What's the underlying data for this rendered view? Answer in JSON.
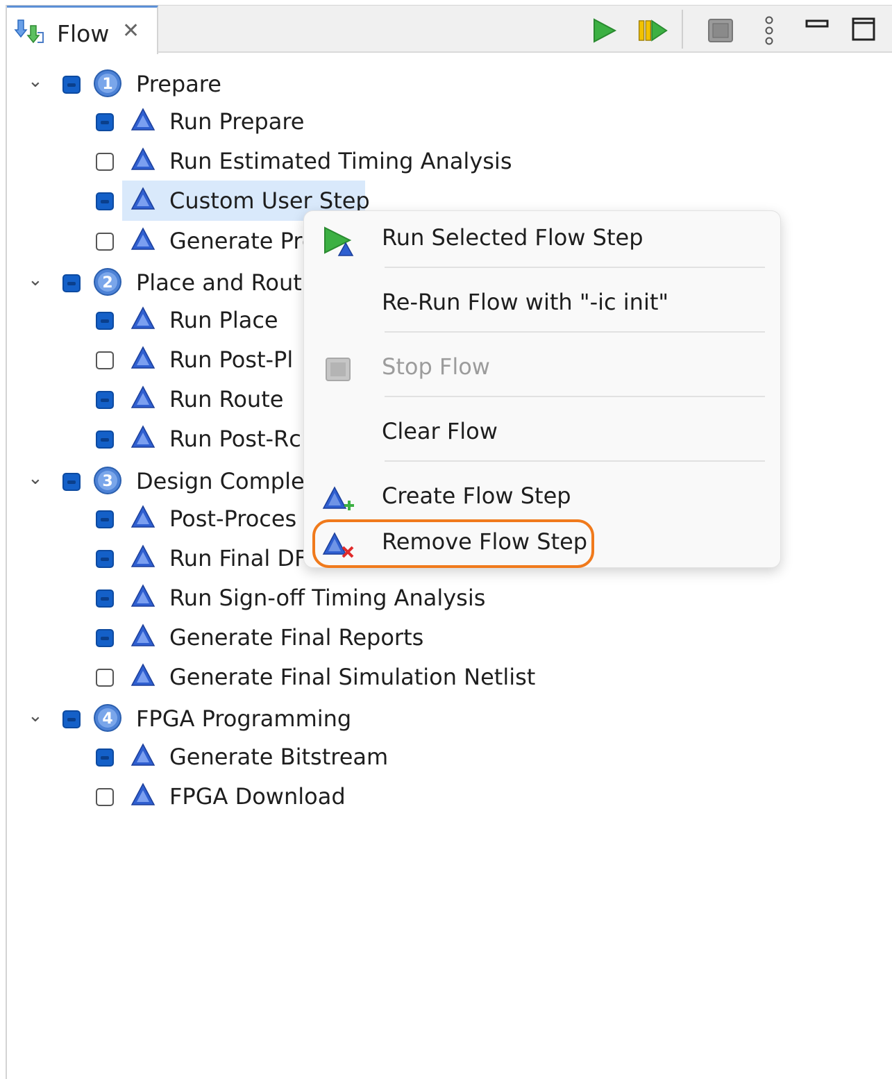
{
  "tab": {
    "title": "Flow",
    "icon": "flow-icon",
    "close_icon": "close-icon"
  },
  "toolbar": {
    "icons": [
      "run-icon",
      "run-from-icon",
      "stop-icon",
      "view-menu-icon",
      "minimize-icon",
      "maximize-icon"
    ]
  },
  "tree": {
    "groups": [
      {
        "label": "Prepare",
        "number": "1",
        "checked": true,
        "steps": [
          {
            "label": "Run Prepare",
            "checked": true
          },
          {
            "label": "Run Estimated Timing Analysis",
            "checked": false
          },
          {
            "label": "Custom User Step",
            "checked": true,
            "selected": true
          },
          {
            "label": "Generate Pre",
            "checked": false
          }
        ]
      },
      {
        "label": "Place and Rout",
        "number": "2",
        "checked": true,
        "steps": [
          {
            "label": "Run Place",
            "checked": true
          },
          {
            "label": "Run Post-Pl",
            "checked": false
          },
          {
            "label": "Run Route",
            "checked": true
          },
          {
            "label": "Run Post-Rc",
            "checked": true
          }
        ]
      },
      {
        "label": "Design Comple",
        "number": "3",
        "checked": true,
        "steps": [
          {
            "label": "Post-Proces",
            "checked": true
          },
          {
            "label": "Run Final DF",
            "checked": true
          },
          {
            "label": "Run Sign-off Timing Analysis",
            "checked": true
          },
          {
            "label": "Generate Final Reports",
            "checked": true
          },
          {
            "label": "Generate Final Simulation Netlist",
            "checked": false
          }
        ]
      },
      {
        "label": "FPGA Programming",
        "number": "4",
        "checked": true,
        "steps": [
          {
            "label": "Generate Bitstream",
            "checked": true
          },
          {
            "label": "FPGA Download",
            "checked": false
          }
        ]
      }
    ]
  },
  "context_menu": {
    "items": [
      {
        "label": "Run Selected Flow Step",
        "icon": "run-step-icon",
        "enabled": true
      },
      {
        "label": "Re-Run Flow with \"-ic init\"",
        "icon": "",
        "enabled": true
      },
      {
        "label": "Stop Flow",
        "icon": "stop-icon",
        "enabled": false
      },
      {
        "label": "Clear Flow",
        "icon": "",
        "enabled": true
      },
      {
        "label": "Create Flow Step",
        "icon": "create-step-icon",
        "enabled": true
      },
      {
        "label": "Remove Flow Step",
        "icon": "remove-step-icon",
        "enabled": true,
        "highlighted": true
      }
    ]
  },
  "colors": {
    "accent": "#1460c8",
    "highlight_ring": "#f07a1c",
    "selection": "#d9e9fb",
    "run_green": "#3cb043"
  }
}
